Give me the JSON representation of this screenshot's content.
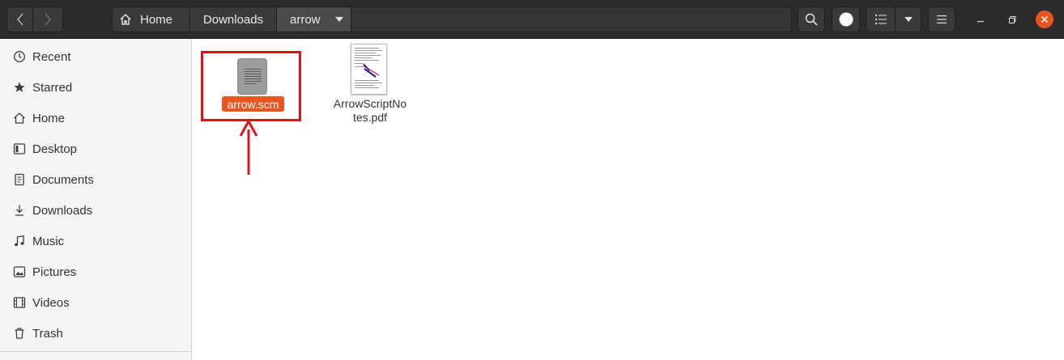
{
  "header": {
    "breadcrumbs": [
      {
        "label": "Home"
      },
      {
        "label": "Downloads"
      },
      {
        "label": "arrow"
      }
    ]
  },
  "sidebar": {
    "items": [
      {
        "label": "Recent",
        "icon": "clock-icon"
      },
      {
        "label": "Starred",
        "icon": "star-icon"
      },
      {
        "label": "Home",
        "icon": "home-icon"
      },
      {
        "label": "Desktop",
        "icon": "desktop-icon"
      },
      {
        "label": "Documents",
        "icon": "document-icon"
      },
      {
        "label": "Downloads",
        "icon": "download-icon"
      },
      {
        "label": "Music",
        "icon": "music-icon"
      },
      {
        "label": "Pictures",
        "icon": "pictures-icon"
      },
      {
        "label": "Videos",
        "icon": "video-icon"
      },
      {
        "label": "Trash",
        "icon": "trash-icon"
      }
    ]
  },
  "files": [
    {
      "name": "arrow.scm",
      "selected": true,
      "icon": "text-file-icon"
    },
    {
      "name": "ArrowScriptNotes.pdf",
      "selected": false,
      "icon": "pdf-thumbnail"
    }
  ],
  "colors": {
    "accent": "#e95420",
    "highlight": "#e0101a",
    "headerbar": "#2c2c2c"
  }
}
